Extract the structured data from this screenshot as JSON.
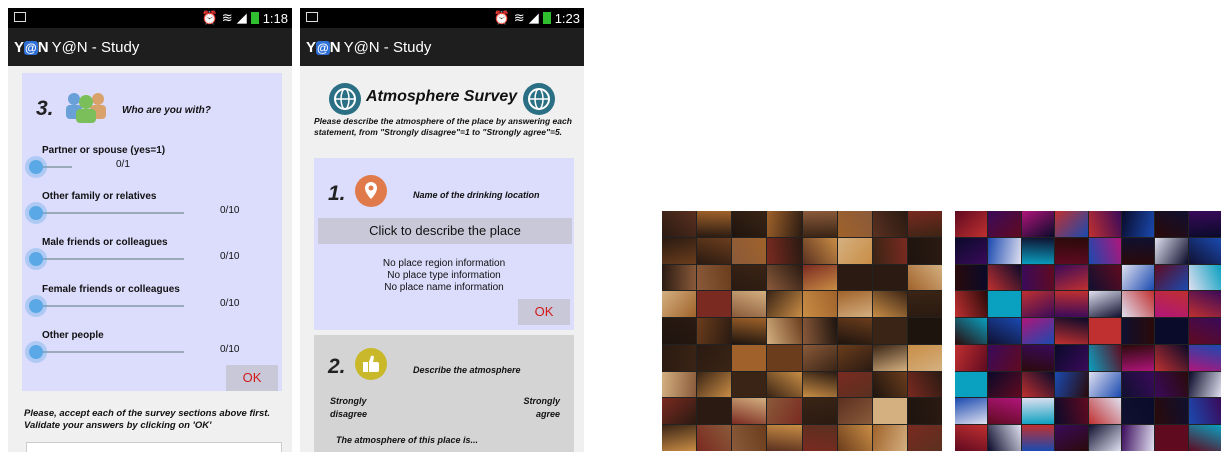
{
  "phone1": {
    "status_time": "1:18",
    "app_title": "Y@N - Study",
    "section_number": "3.",
    "section_title": "Who are you with?",
    "questions": [
      {
        "label": "Partner or spouse (yes=1)",
        "value": "0/1"
      },
      {
        "label": "Other family or relatives",
        "value": "0/10"
      },
      {
        "label": "Male friends or colleagues",
        "value": "0/10"
      },
      {
        "label": "Female friends or colleagues",
        "value": "0/10"
      },
      {
        "label": "Other people",
        "value": "0/10"
      }
    ],
    "ok_label": "OK",
    "footer_note": "Please, accept each of the survey sections above first. Validate your answers by clicking on 'OK'"
  },
  "phone2": {
    "status_time": "1:23",
    "app_title": "Y@N - Study",
    "survey_title": "Atmosphere Survey",
    "instructions": "Please describe the atmosphere of the place by answering each statement, from \"Strongly disagree\"=1 to \"Strongly agree\"=5.",
    "section1_number": "1.",
    "section1_title": "Name of the drinking location",
    "describe_button": "Click to describe the place",
    "info_lines": [
      "No place region information",
      "No place type information",
      "No place name information"
    ],
    "ok_label": "OK",
    "section2_number": "2.",
    "section2_title": "Describe the atmosphere",
    "scale_left": "Strongly disagree",
    "scale_right": "Strongly agree",
    "statement": "The atmosphere of this place is..."
  },
  "colors": {
    "accent_card": "#dcdcfc",
    "ok_text": "#d21a1a",
    "knob": "#5aa9e6"
  }
}
